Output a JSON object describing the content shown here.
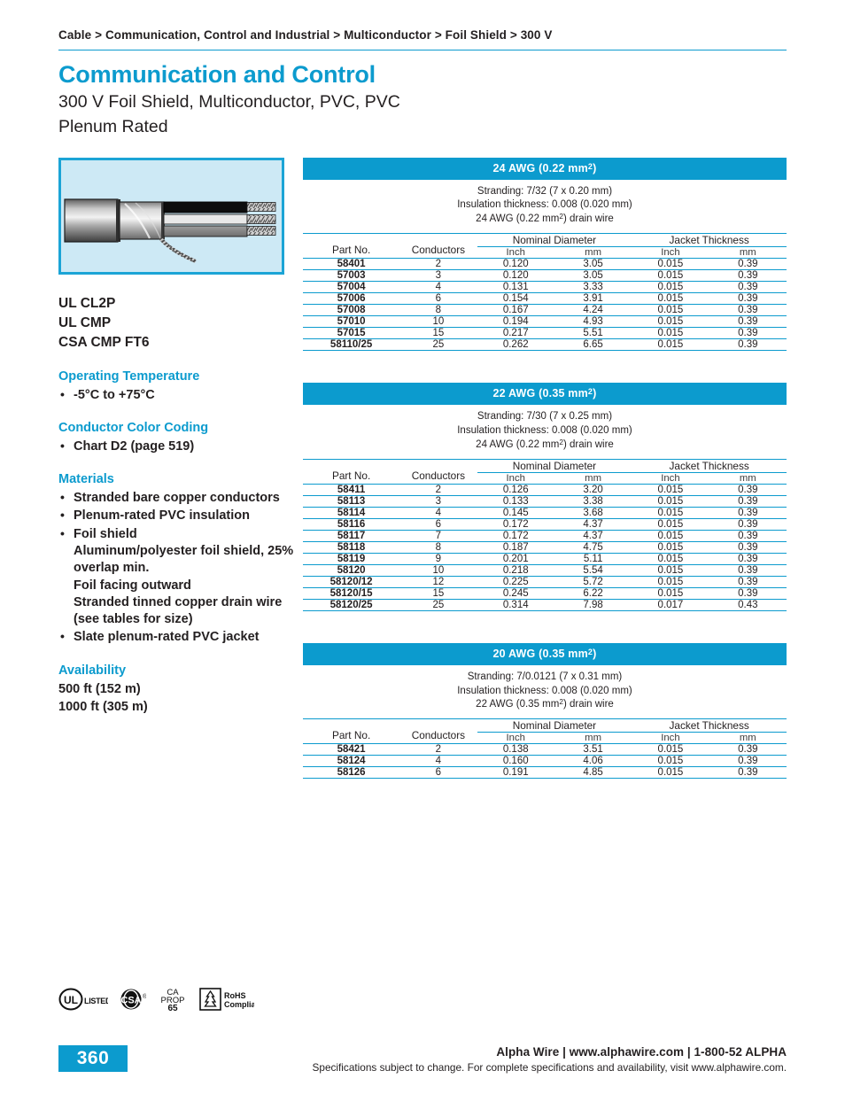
{
  "breadcrumb": "Cable > Communication, Control and Industrial > Multiconductor > Foil Shield > 300 V",
  "title": {
    "main": "Communication and Control",
    "sub_line1": "300 V Foil Shield, Multiconductor, PVC, PVC",
    "sub_line2": "Plenum Rated"
  },
  "figure": {
    "alt": "cable-cutaway-illustration",
    "border_color": "#1ba4d6",
    "background_color": "#cde9f5",
    "conductor_colors": [
      "#0d0d0d",
      "#e8e8e8",
      "#8a8a8a"
    ]
  },
  "approvals": [
    "UL CL2P",
    "UL CMP",
    "CSA CMP FT6"
  ],
  "sections": {
    "operating_temperature": {
      "heading": "Operating Temperature",
      "items": [
        "-5°C to +75°C"
      ]
    },
    "conductor_color_coding": {
      "heading": "Conductor Color Coding",
      "items": [
        "Chart D2 (page 519)"
      ]
    },
    "materials": {
      "heading": "Materials",
      "items": [
        {
          "main": "Stranded bare copper conductors",
          "subs": []
        },
        {
          "main": "Plenum-rated PVC insulation",
          "subs": []
        },
        {
          "main": "Foil shield",
          "subs": [
            "Aluminum/polyester foil shield, 25% overlap min.",
            "Foil facing outward",
            "Stranded tinned copper drain wire (see tables for size)"
          ]
        },
        {
          "main": "Slate plenum-rated PVC jacket",
          "subs": []
        }
      ]
    },
    "availability": {
      "heading": "Availability",
      "lines": [
        "500 ft (152 m)",
        "1000 ft (305 m)"
      ]
    }
  },
  "table_columns": {
    "part_no": "Part No.",
    "conductors": "Conductors",
    "nominal_diameter": "Nominal Diameter",
    "jacket_thickness": "Jacket Thickness",
    "inch": "Inch",
    "mm": "mm"
  },
  "tables": [
    {
      "id": "awg-24",
      "bar_title": "24 AWG (0.22 mm²)",
      "notes": [
        "Stranding: 7/32 (7 x 0.20 mm)",
        "Insulation thickness: 0.008 (0.020 mm)",
        "24 AWG (0.22 mm²) drain wire"
      ],
      "rows": [
        {
          "part_no": "58401",
          "conductors": "2",
          "dia_inch": "0.120",
          "dia_mm": "3.05",
          "jkt_inch": "0.015",
          "jkt_mm": "0.39"
        },
        {
          "part_no": "57003",
          "conductors": "3",
          "dia_inch": "0.120",
          "dia_mm": "3.05",
          "jkt_inch": "0.015",
          "jkt_mm": "0.39"
        },
        {
          "part_no": "57004",
          "conductors": "4",
          "dia_inch": "0.131",
          "dia_mm": "3.33",
          "jkt_inch": "0.015",
          "jkt_mm": "0.39"
        },
        {
          "part_no": "57006",
          "conductors": "6",
          "dia_inch": "0.154",
          "dia_mm": "3.91",
          "jkt_inch": "0.015",
          "jkt_mm": "0.39"
        },
        {
          "part_no": "57008",
          "conductors": "8",
          "dia_inch": "0.167",
          "dia_mm": "4.24",
          "jkt_inch": "0.015",
          "jkt_mm": "0.39"
        },
        {
          "part_no": "57010",
          "conductors": "10",
          "dia_inch": "0.194",
          "dia_mm": "4.93",
          "jkt_inch": "0.015",
          "jkt_mm": "0.39"
        },
        {
          "part_no": "57015",
          "conductors": "15",
          "dia_inch": "0.217",
          "dia_mm": "5.51",
          "jkt_inch": "0.015",
          "jkt_mm": "0.39"
        },
        {
          "part_no": "58110/25",
          "conductors": "25",
          "dia_inch": "0.262",
          "dia_mm": "6.65",
          "jkt_inch": "0.015",
          "jkt_mm": "0.39"
        }
      ]
    },
    {
      "id": "awg-22",
      "bar_title": "22 AWG (0.35 mm²)",
      "notes": [
        "Stranding: 7/30 (7 x 0.25 mm)",
        "Insulation thickness: 0.008 (0.020 mm)",
        "24 AWG (0.22 mm²) drain wire"
      ],
      "rows": [
        {
          "part_no": "58411",
          "conductors": "2",
          "dia_inch": "0.126",
          "dia_mm": "3.20",
          "jkt_inch": "0.015",
          "jkt_mm": "0.39"
        },
        {
          "part_no": "58113",
          "conductors": "3",
          "dia_inch": "0.133",
          "dia_mm": "3.38",
          "jkt_inch": "0.015",
          "jkt_mm": "0.39"
        },
        {
          "part_no": "58114",
          "conductors": "4",
          "dia_inch": "0.145",
          "dia_mm": "3.68",
          "jkt_inch": "0.015",
          "jkt_mm": "0.39"
        },
        {
          "part_no": "58116",
          "conductors": "6",
          "dia_inch": "0.172",
          "dia_mm": "4.37",
          "jkt_inch": "0.015",
          "jkt_mm": "0.39"
        },
        {
          "part_no": "58117",
          "conductors": "7",
          "dia_inch": "0.172",
          "dia_mm": "4.37",
          "jkt_inch": "0.015",
          "jkt_mm": "0.39"
        },
        {
          "part_no": "58118",
          "conductors": "8",
          "dia_inch": "0.187",
          "dia_mm": "4.75",
          "jkt_inch": "0.015",
          "jkt_mm": "0.39"
        },
        {
          "part_no": "58119",
          "conductors": "9",
          "dia_inch": "0.201",
          "dia_mm": "5.11",
          "jkt_inch": "0.015",
          "jkt_mm": "0.39"
        },
        {
          "part_no": "58120",
          "conductors": "10",
          "dia_inch": "0.218",
          "dia_mm": "5.54",
          "jkt_inch": "0.015",
          "jkt_mm": "0.39"
        },
        {
          "part_no": "58120/12",
          "conductors": "12",
          "dia_inch": "0.225",
          "dia_mm": "5.72",
          "jkt_inch": "0.015",
          "jkt_mm": "0.39"
        },
        {
          "part_no": "58120/15",
          "conductors": "15",
          "dia_inch": "0.245",
          "dia_mm": "6.22",
          "jkt_inch": "0.015",
          "jkt_mm": "0.39"
        },
        {
          "part_no": "58120/25",
          "conductors": "25",
          "dia_inch": "0.314",
          "dia_mm": "7.98",
          "jkt_inch": "0.017",
          "jkt_mm": "0.43"
        }
      ]
    },
    {
      "id": "awg-20",
      "bar_title": "20 AWG (0.35 mm²)",
      "notes": [
        "Stranding: 7/0.0121 (7 x 0.31 mm)",
        "Insulation thickness: 0.008 (0.020 mm)",
        "22 AWG (0.35 mm²) drain wire"
      ],
      "rows": [
        {
          "part_no": "58421",
          "conductors": "2",
          "dia_inch": "0.138",
          "dia_mm": "3.51",
          "jkt_inch": "0.015",
          "jkt_mm": "0.39"
        },
        {
          "part_no": "58124",
          "conductors": "4",
          "dia_inch": "0.160",
          "dia_mm": "4.06",
          "jkt_inch": "0.015",
          "jkt_mm": "0.39"
        },
        {
          "part_no": "58126",
          "conductors": "6",
          "dia_inch": "0.191",
          "dia_mm": "4.85",
          "jkt_inch": "0.015",
          "jkt_mm": "0.39"
        }
      ]
    }
  ],
  "certifications": [
    {
      "name": "ul-listed-mark",
      "main": "UL",
      "label": "LISTED"
    },
    {
      "name": "csa-mark",
      "main": "CSA",
      "label": ""
    },
    {
      "name": "ca-prop-65-mark",
      "line1": "CA",
      "line2": "PROP",
      "line3": "65"
    },
    {
      "name": "rohs-compliant-mark",
      "line1": "RoHS",
      "line2": "Compliant"
    }
  ],
  "footer": {
    "page_number": "360",
    "line1": "Alpha Wire | www.alphawire.com | 1-800-52 ALPHA",
    "line2": "Specifications subject to change. For complete specifications and availability, visit www.alphawire.com."
  },
  "colors": {
    "accent": "#0c9bce",
    "text": "#231f20"
  }
}
